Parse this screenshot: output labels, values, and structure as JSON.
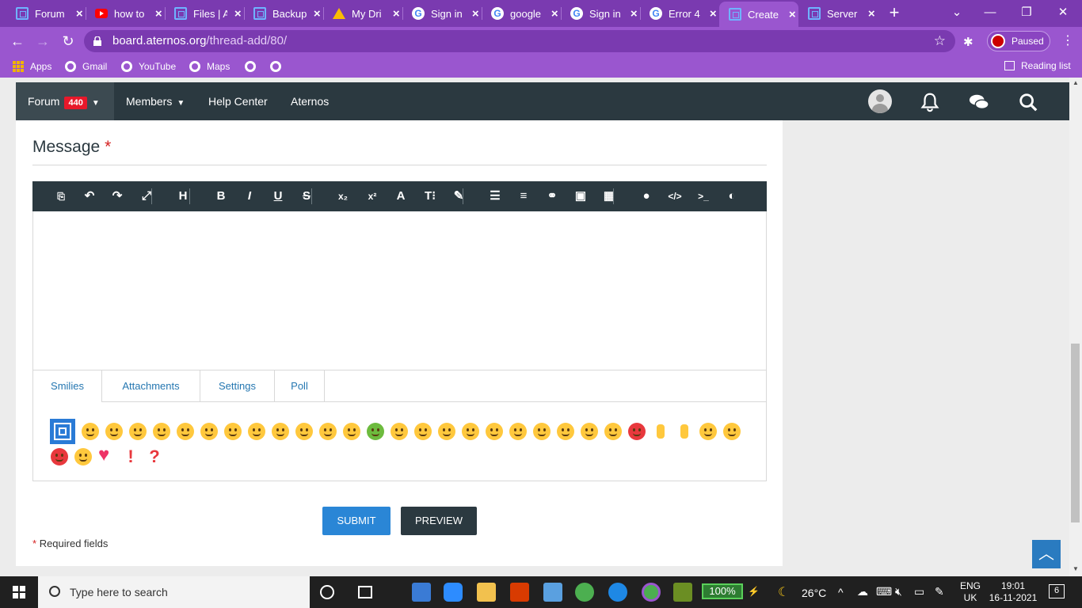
{
  "browser": {
    "tabs": [
      {
        "title": "Forum",
        "favicon": "aternos-icon"
      },
      {
        "title": "how to",
        "favicon": "youtube-icon"
      },
      {
        "title": "Files | A",
        "favicon": "aternos-icon"
      },
      {
        "title": "Backup",
        "favicon": "aternos-icon"
      },
      {
        "title": "My Dri",
        "favicon": "google-drive-icon"
      },
      {
        "title": "Sign in",
        "favicon": "google-icon"
      },
      {
        "title": "google",
        "favicon": "google-icon"
      },
      {
        "title": "Sign in",
        "favicon": "google-icon"
      },
      {
        "title": "Error 4",
        "favicon": "google-icon"
      },
      {
        "title": "Create",
        "favicon": "aternos-icon",
        "active": true
      },
      {
        "title": "Server",
        "favicon": "aternos-icon"
      }
    ],
    "url_host": "board.aternos.org",
    "url_path": "/thread-add/80/",
    "profile_label": "Paused",
    "bookmarks": [
      "Apps",
      "Gmail",
      "YouTube",
      "Maps",
      "",
      ""
    ],
    "reading_list": "Reading list"
  },
  "site_nav": {
    "forum": "Forum",
    "forum_badge": "440",
    "members": "Members",
    "help_center": "Help Center",
    "aternos": "Aternos"
  },
  "form": {
    "message_label": "Message",
    "required_mark": "*",
    "tabs": [
      "Smilies",
      "Attachments",
      "Settings",
      "Poll"
    ],
    "submit": "SUBMIT",
    "preview": "PREVIEW",
    "required_note": "Required fields"
  },
  "editor_toolbar": [
    {
      "name": "source-code-icon",
      "glyph": "⎘"
    },
    {
      "name": "undo-icon",
      "glyph": "↶"
    },
    {
      "name": "redo-icon",
      "glyph": "↷"
    },
    {
      "name": "fullscreen-icon",
      "glyph": "⤢"
    },
    {
      "name": "heading-icon",
      "glyph": "H"
    },
    {
      "name": "bold-icon",
      "glyph": "B"
    },
    {
      "name": "italic-icon",
      "glyph": "I"
    },
    {
      "name": "underline-icon",
      "glyph": "U"
    },
    {
      "name": "strikethrough-icon",
      "glyph": "S"
    },
    {
      "name": "subscript-icon",
      "glyph": "x₂"
    },
    {
      "name": "superscript-icon",
      "glyph": "x²"
    },
    {
      "name": "font-color-icon",
      "glyph": "A"
    },
    {
      "name": "font-size-icon",
      "glyph": "T⁝"
    },
    {
      "name": "brush-icon",
      "glyph": "✎"
    },
    {
      "name": "list-icon",
      "glyph": "☰"
    },
    {
      "name": "align-icon",
      "glyph": "≡"
    },
    {
      "name": "link-icon",
      "glyph": "⚭"
    },
    {
      "name": "image-icon",
      "glyph": "▣"
    },
    {
      "name": "table-icon",
      "glyph": "▦"
    },
    {
      "name": "quote-icon",
      "glyph": "●"
    },
    {
      "name": "code-icon",
      "glyph": "</>"
    },
    {
      "name": "inline-code-icon",
      "glyph": ">_"
    },
    {
      "name": "spoiler-icon",
      "glyph": "◐"
    }
  ],
  "taskbar": {
    "search_placeholder": "Type here to search",
    "battery": "100%",
    "temperature": "26°C",
    "lang_top": "ENG",
    "lang_bottom": "UK",
    "time": "19:01",
    "date": "16-11-2021",
    "notifications": "6"
  },
  "colors": {
    "browser_purple": "#9a56cf",
    "nav_dark": "#2b3940",
    "accent_blue": "#2a86d6",
    "required_red": "#d52222"
  }
}
